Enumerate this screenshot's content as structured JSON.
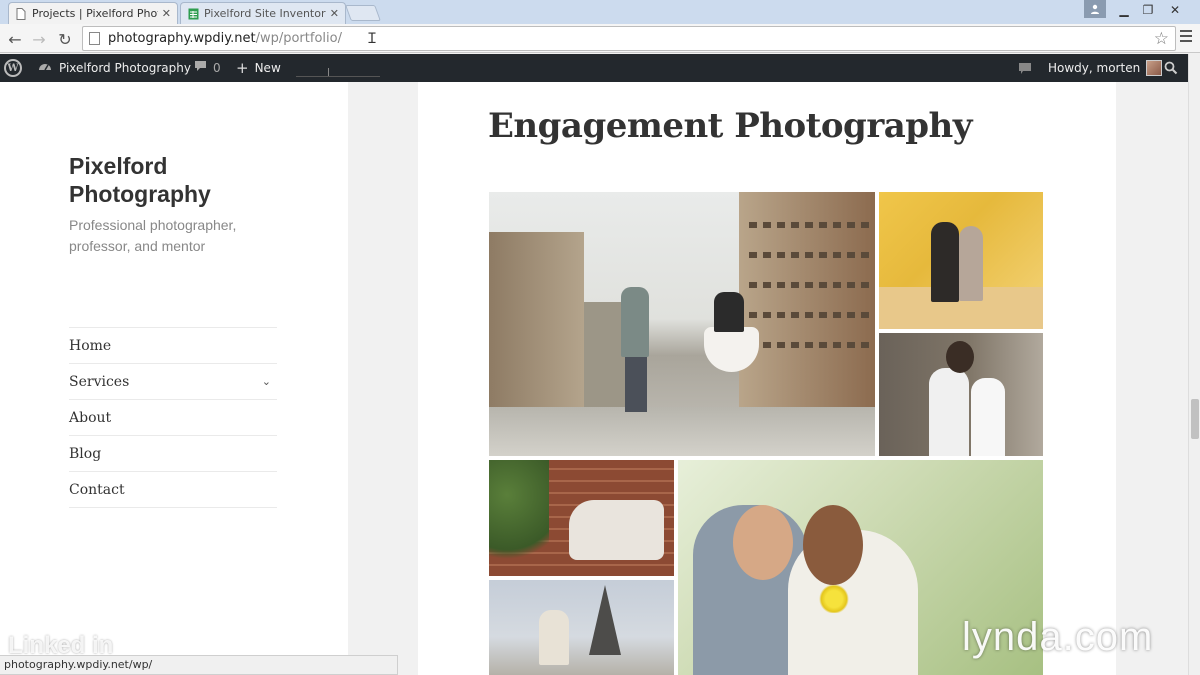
{
  "browser": {
    "tabs": [
      {
        "label": "Projects | Pixelford Photog",
        "active": true,
        "icon": "page-icon"
      },
      {
        "label": "Pixelford Site Inventory - (",
        "active": false,
        "icon": "sheets-icon"
      }
    ],
    "url_host": "photography.wpdiy.net",
    "url_path": "/wp/portfolio/"
  },
  "adminbar": {
    "site_name": "Pixelford Photography",
    "comment_count": "0",
    "new_label": "New",
    "greeting": "Howdy, morten"
  },
  "site": {
    "title": "Pixelford Photography",
    "description": "Professional photographer, professor, and mentor"
  },
  "nav": [
    {
      "label": "Home",
      "has_submenu": false
    },
    {
      "label": "Services",
      "has_submenu": true
    },
    {
      "label": "About",
      "has_submenu": false
    },
    {
      "label": "Blog",
      "has_submenu": false
    },
    {
      "label": "Contact",
      "has_submenu": false
    }
  ],
  "content": {
    "title": "Engagement Photography",
    "gallery_count": 6
  },
  "status": {
    "link_preview": "photography.wpdiy.net/wp/"
  },
  "watermarks": {
    "left": "Linked in",
    "right": "lynda.com"
  },
  "colors": {
    "admin_bar": "#23282d",
    "page_bg": "#f1f1f1",
    "tab_strip": "#ccdbee"
  }
}
